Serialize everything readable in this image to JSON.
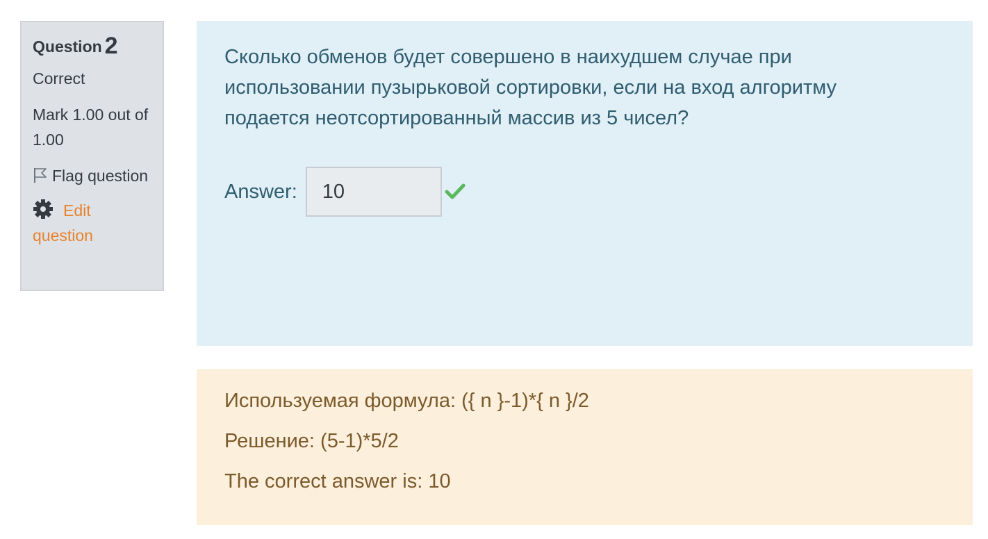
{
  "info": {
    "question_label": "Question",
    "question_number": "2",
    "state": "Correct",
    "grade": "Mark 1.00 out of 1.00",
    "flag_label": "Flag question",
    "edit_label": "Edit question"
  },
  "question": {
    "text": "Сколько обменов будет совершено в наихудшем случае при использовании пузырьковой сортировки, если на вход алгоритму подается неотсортированный массив из 5 чисел?",
    "answer_label": "Answer:",
    "answer_value": "10"
  },
  "feedback": {
    "formula": "Используемая формула: ({ n }-1)*{ n }/2",
    "solution": "Решение: (5-1)*5/2",
    "correct_answer": "The correct answer is: 10"
  },
  "colors": {
    "info_bg": "#dee2e6",
    "question_bg": "#e1eff7",
    "feedback_bg": "#fcefdc",
    "link": "#e8822d",
    "correct": "#5cb85c"
  }
}
